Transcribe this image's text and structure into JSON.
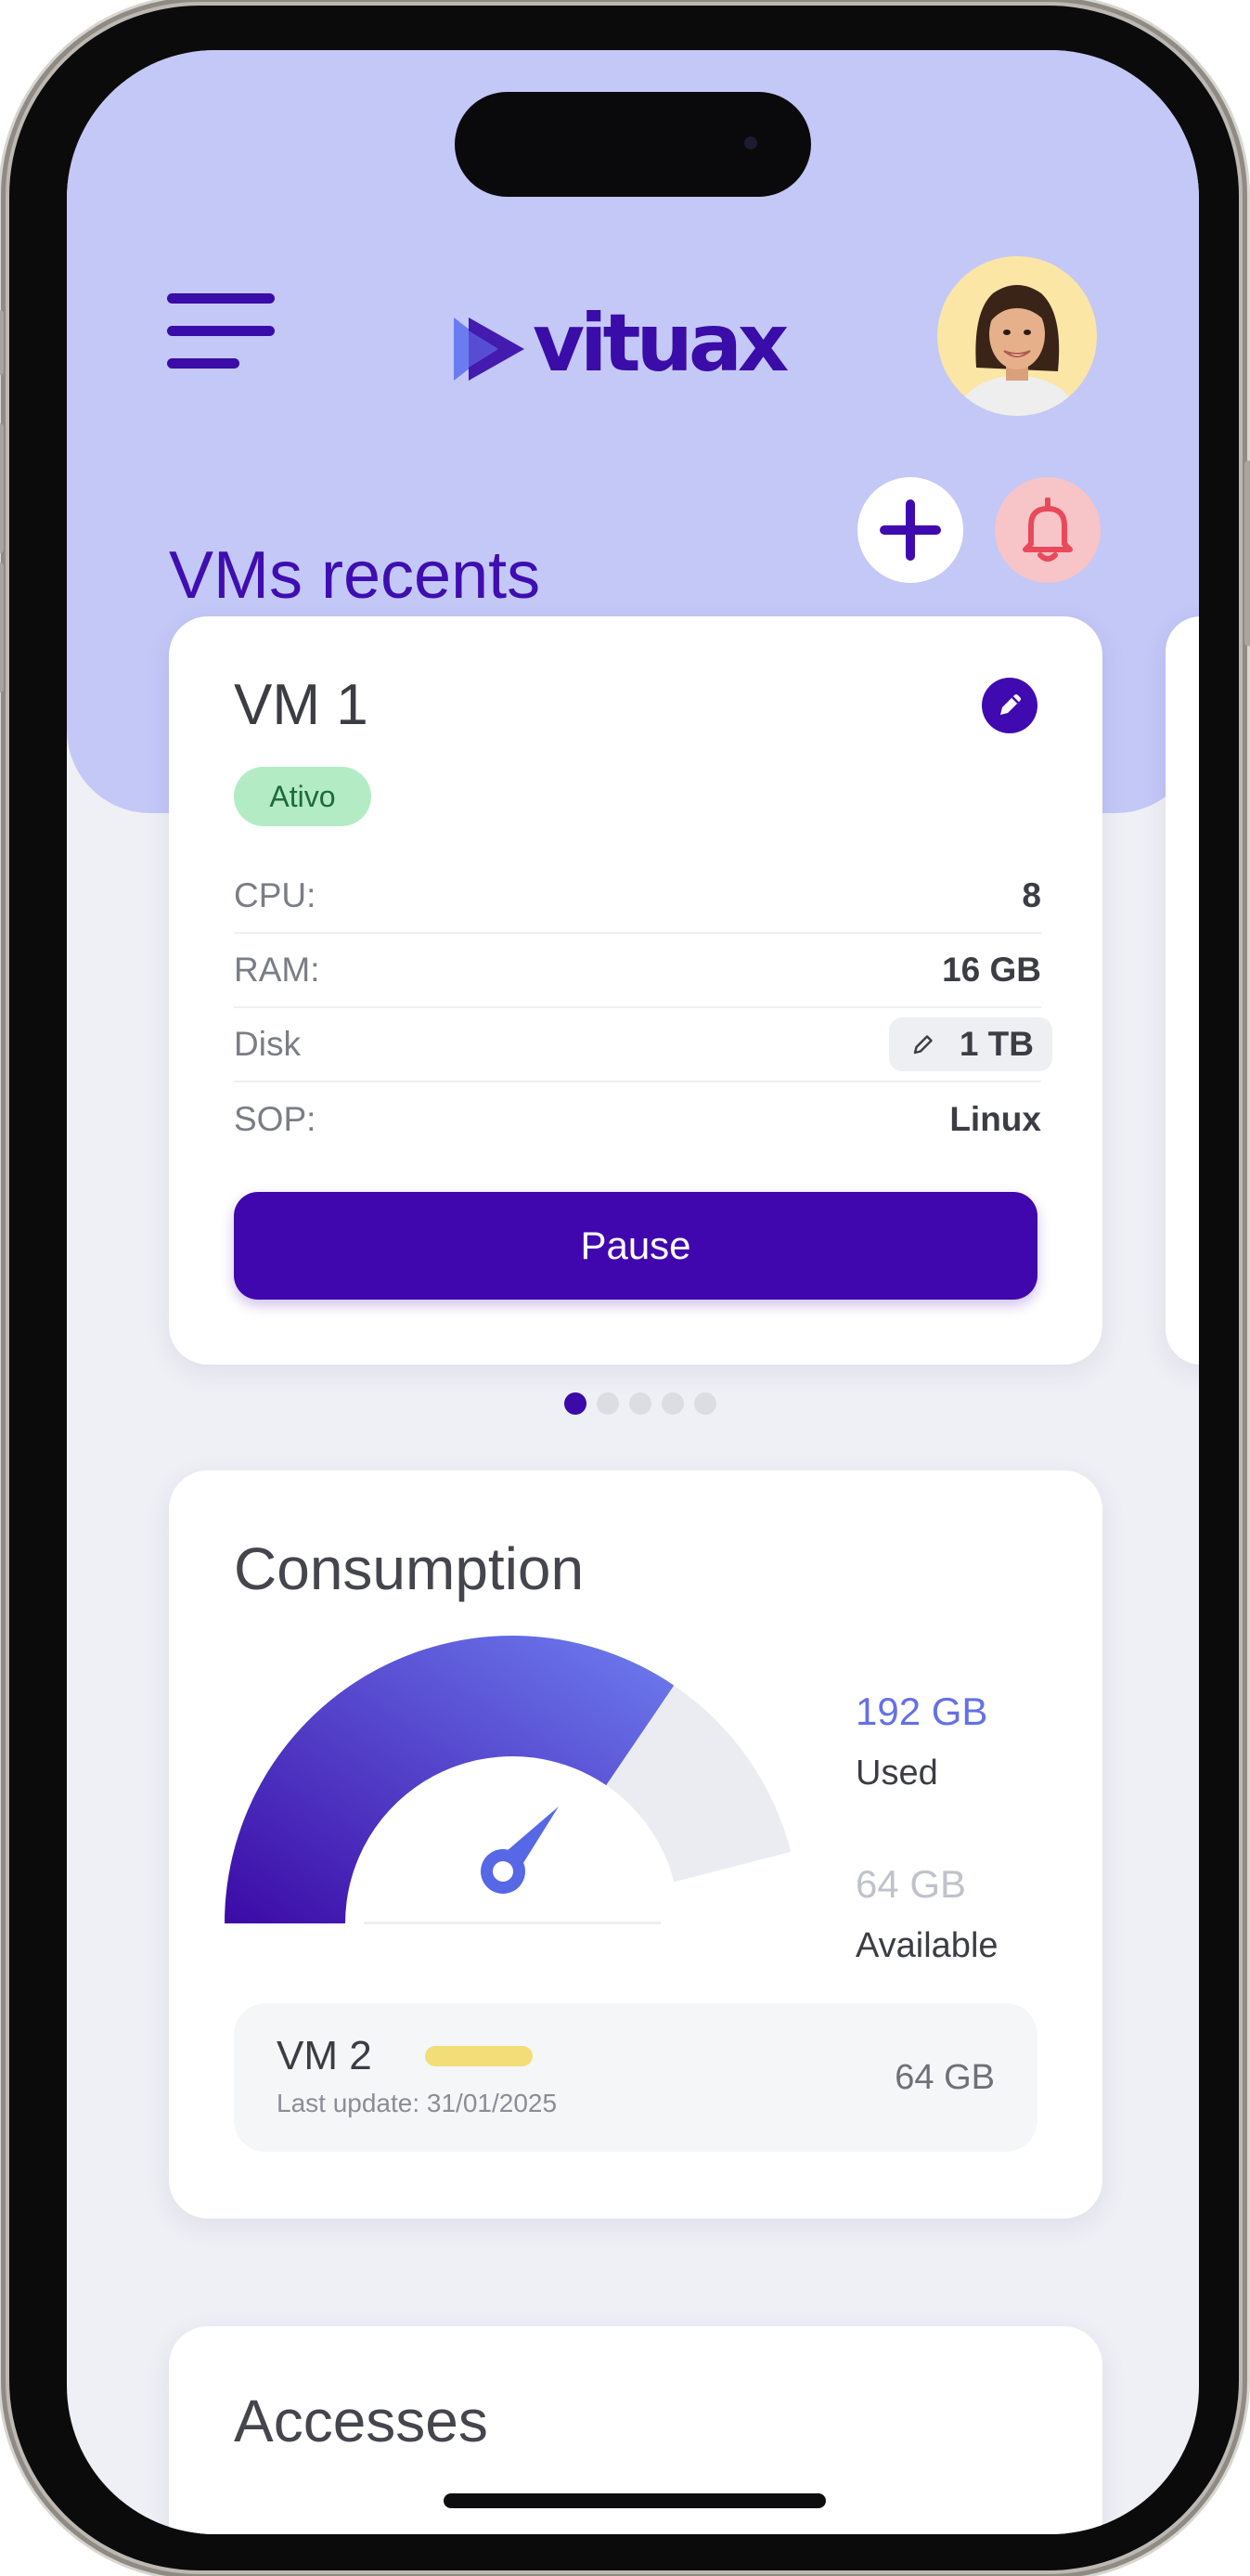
{
  "app": {
    "brand": "vituax",
    "colors": {
      "accent": "#3f0bb0",
      "header_bg": "#c3c8f7",
      "status_active": "#b3ecc4",
      "used": "#6570e8",
      "available": "#c0c2cb",
      "vm2_bar": "#f2dd79"
    }
  },
  "header": {
    "menu_icon": "hamburger-menu-icon",
    "avatar_icon": "user-avatar",
    "section_title": "VMs recents",
    "add_icon": "plus-icon",
    "notification_icon": "bell-icon"
  },
  "vm_card": {
    "title": "VM 1",
    "edit_icon": "pencil-icon",
    "status": "Ativo",
    "specs": [
      {
        "label": "CPU:",
        "value": "8"
      },
      {
        "label": "RAM:",
        "value": "16 GB"
      },
      {
        "label": "Disk",
        "value": "1 TB"
      },
      {
        "label": "SOP:",
        "value": "Linux"
      }
    ],
    "primary_action": "Pause"
  },
  "carousel": {
    "count": 5,
    "active_index": 0
  },
  "consumption": {
    "title": "Consumption",
    "used_value": "192 GB",
    "used_label": "Used",
    "available_value": "64 GB",
    "available_label": "Available",
    "gauge_used_fraction": 0.75,
    "gauge_icon": "gauge-needle-icon",
    "recent": {
      "name": "VM 2",
      "updated": "Last update: 31/01/2025",
      "size": "64 GB"
    }
  },
  "accesses": {
    "title": "Accesses"
  }
}
